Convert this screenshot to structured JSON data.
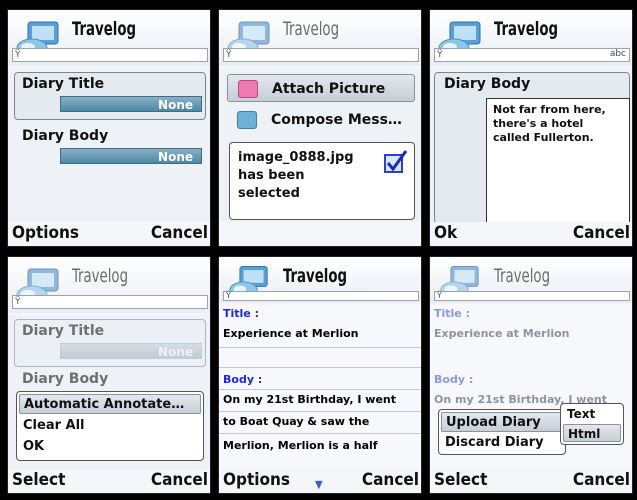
{
  "app_title": "Travelog",
  "screen1": {
    "diary_title_label": "Diary Title",
    "diary_title_value": "None",
    "diary_body_label": "Diary Body",
    "diary_body_value": "None",
    "left_soft": "Options",
    "right_soft": "Cancel"
  },
  "screen2": {
    "menu_items": [
      "Attach Picture",
      "Compose Mess…"
    ],
    "popup_lines": [
      "image_0888.jpg",
      "has been",
      "selected"
    ]
  },
  "screen3": {
    "input_mode": "abc",
    "diary_body_label": "Diary Body",
    "body_text_lines": [
      "Not far from here,",
      "there's a hotel",
      "called Fullerton."
    ],
    "left_soft": "Ok",
    "right_soft": "Cancel"
  },
  "screen4": {
    "diary_title_label": "Diary Title",
    "diary_title_value": "None",
    "diary_body_label": "Diary Body",
    "options": [
      "Automatic Annotate…",
      "Clear All",
      "OK"
    ],
    "left_soft": "Select",
    "right_soft": "Cancel"
  },
  "screen5": {
    "title_label": "Title :",
    "title_value": "Experience at Merlion",
    "body_label": "Body :",
    "body_lines": [
      "On my 21st Birthday, I went",
      "to Boat Quay & saw the",
      "Merlion, Merlion is a half"
    ],
    "left_soft": "Options",
    "right_soft": "Cancel"
  },
  "screen6": {
    "title_label": "Title :",
    "title_value": "Experience at Merlion",
    "body_label": "Body :",
    "body_line": "On my 21st Birthday, I went",
    "options": [
      "Upload Diary",
      "Discard Diary"
    ],
    "submenu": [
      "Text",
      "Html"
    ],
    "left_soft": "Select",
    "right_soft": "Cancel"
  },
  "icons": {
    "logo": "travelog-logo-icon",
    "signal": "signal-icon",
    "picture": "picture-icon",
    "compose": "compose-icon",
    "check": "checkbox-icon",
    "scroll": "scroll-down-icon"
  },
  "colors": {
    "field_fill": "#4a8aa8",
    "label_blue": "#1e28d8",
    "selection": "#c7ced6"
  }
}
